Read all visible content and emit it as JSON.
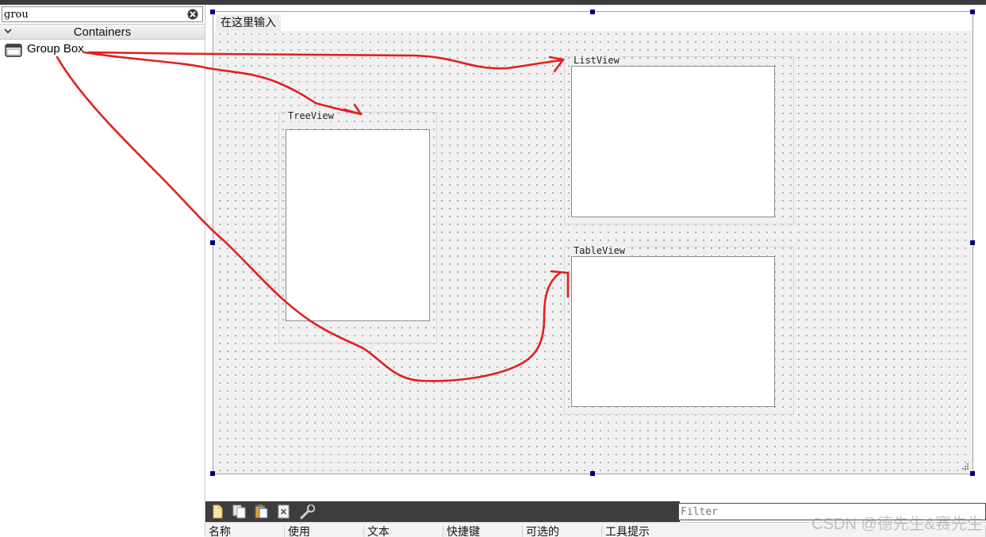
{
  "widget_box": {
    "search_value": "grou",
    "category": "Containers",
    "items": [
      {
        "label": "Group Box",
        "icon": "group-box-icon"
      }
    ]
  },
  "form": {
    "menu_placeholder": "在这里输入",
    "groupboxes": [
      {
        "title": "TreeView"
      },
      {
        "title": "ListView"
      },
      {
        "title": "TableView"
      }
    ]
  },
  "action_editor": {
    "toolbar_icons": [
      "new-action-icon",
      "copy-action-icon",
      "paste-action-icon",
      "delete-action-icon",
      "configure-icon"
    ],
    "filter_placeholder": "Filter",
    "columns": [
      "名称",
      "使用",
      "文本",
      "快捷键",
      "可选的",
      "工具提示"
    ]
  },
  "watermark": "CSDN @德先生&赛先生",
  "colors": {
    "selection_handle": "#00007f",
    "annotation": "#e0201f",
    "toolbar": "#3d3d3d",
    "grid_background": "#f0f0f0"
  }
}
